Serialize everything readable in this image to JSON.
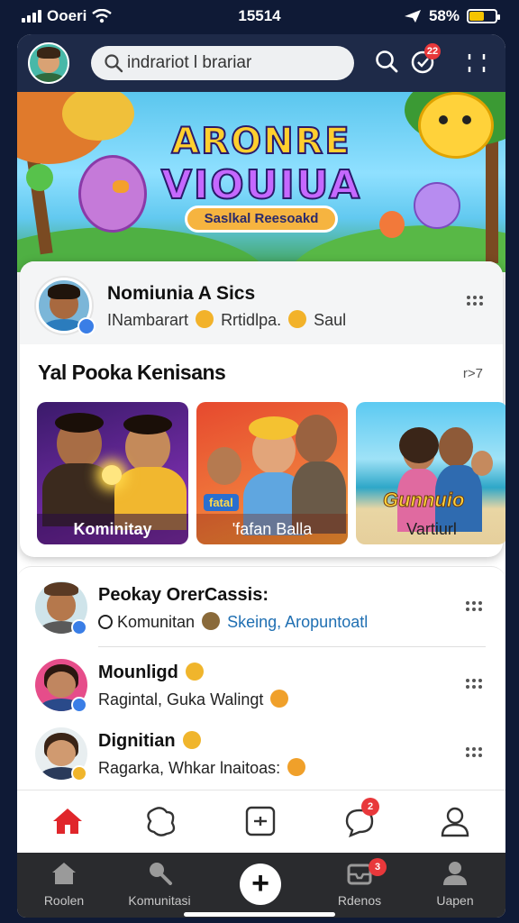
{
  "status": {
    "carrier": "Ooeri",
    "time": "15514",
    "battery": "58%",
    "battery_level": 0.58
  },
  "header": {
    "search_text": "indrariot l brariar",
    "notification_count": "22"
  },
  "banner": {
    "title_line1": "ARONRE",
    "title_line2": "VIOUIUA",
    "pill": "Saslkal Reesoakd"
  },
  "post": {
    "name": "Nomiunia A Sics",
    "sub_left": "INambarart",
    "sub_mid": "Rrtidlpa.",
    "sub_right": "Saul"
  },
  "section": {
    "title": "Yal Pooka Kenisans",
    "more": "r>7"
  },
  "tiles": [
    {
      "label": "Kominitay",
      "accent": "#7a2fb4"
    },
    {
      "label": "'fafan Balla",
      "accent": "#e0543a"
    },
    {
      "label": "Vartiurl",
      "overlay": "Gunnuio",
      "accent": "#3fb3e0"
    }
  ],
  "tile2_sign": "fatal",
  "feed": [
    {
      "name": "Peokay OrerCassis:",
      "sub": "Komunitan",
      "link": "Skeing, Aropuntoatl"
    },
    {
      "name": "Mounligd",
      "sub": "Ragintal, Guka Walingt"
    },
    {
      "name": "Dignitian",
      "sub": "Ragarka, Whkar lnaitoas:"
    }
  ],
  "inner_tabs": {
    "chat_badge": "2"
  },
  "bottom_nav": [
    {
      "label": "Roolen",
      "icon": "home-icon"
    },
    {
      "label": "Komunitasi",
      "icon": "search-icon"
    },
    {
      "label": "+",
      "icon": "plus-icon"
    },
    {
      "label": "Rdenos",
      "icon": "inbox-icon",
      "badge": "3"
    },
    {
      "label": "Uapen",
      "icon": "profile-icon"
    }
  ]
}
